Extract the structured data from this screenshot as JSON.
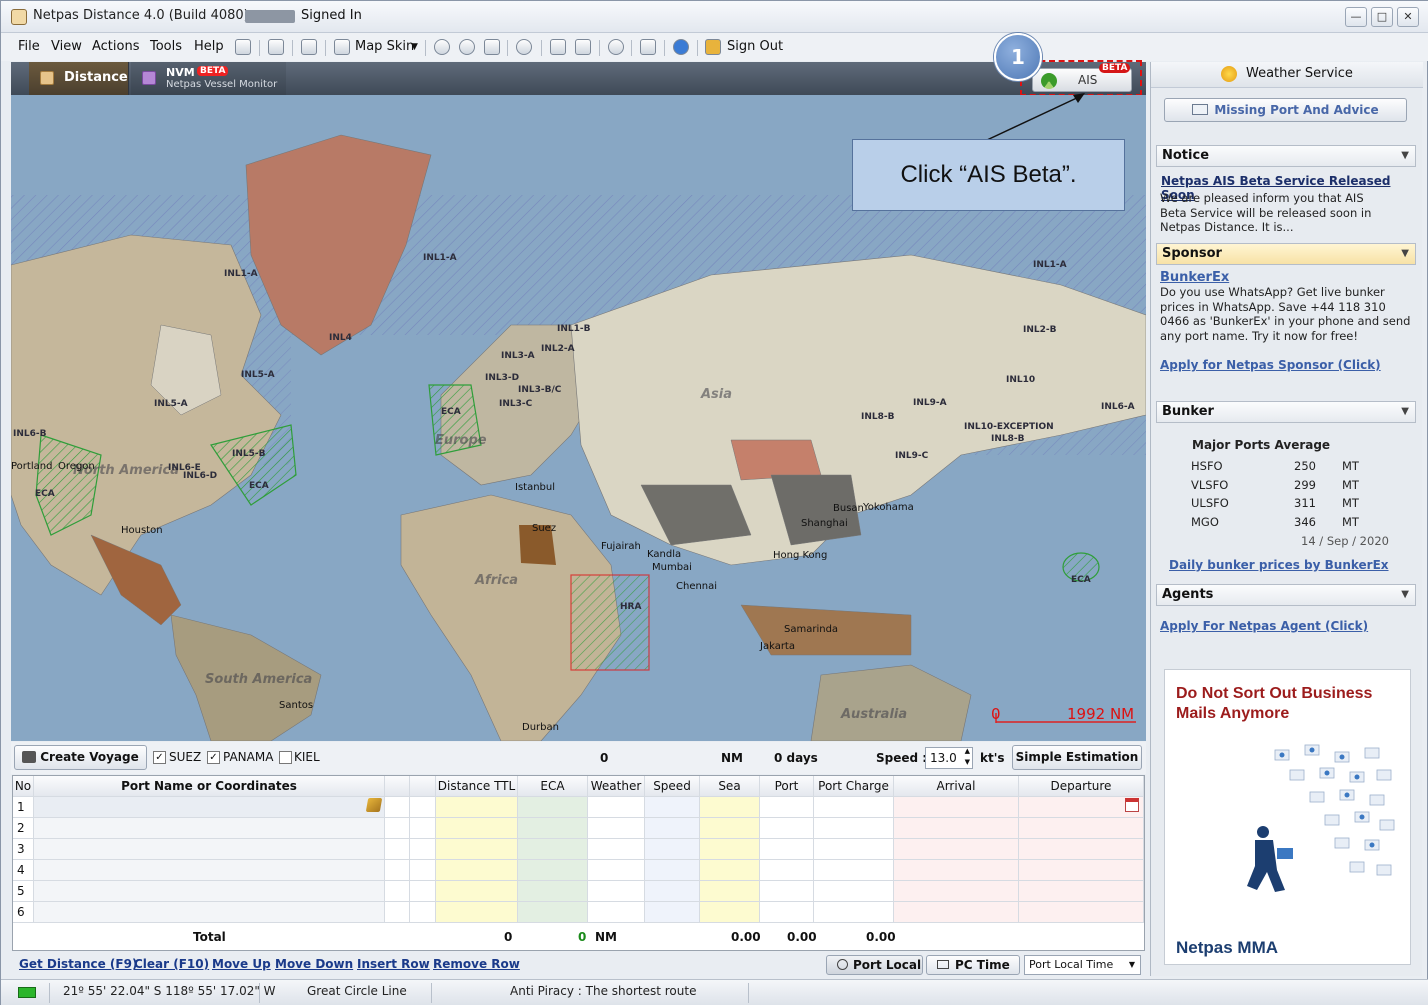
{
  "window": {
    "title": "Netpas Distance 4.0 (Build 4080)  -",
    "signed_in": "Signed In"
  },
  "menu": {
    "items": [
      "File",
      "View",
      "Actions",
      "Tools",
      "Help"
    ],
    "map_skin": "Map Skin",
    "sign_out": "Sign Out"
  },
  "tabs": {
    "distance": "Distance",
    "nvm_title": "NVM",
    "nvm_beta": "BETA",
    "nvm_sub": "Netpas Vessel Monitor",
    "ais": "AIS",
    "ais_beta": "BETA"
  },
  "callout": {
    "number": "1",
    "text": "Click “AIS Beta”."
  },
  "map": {
    "scale_zero": "0",
    "scale_value": "1992 NM",
    "regions": [
      "North America",
      "Europe",
      "Asia",
      "Africa",
      "South America",
      "Australia"
    ],
    "zones": [
      "INL1-A",
      "INL1-A",
      "INL1-A",
      "INL4",
      "INL5-A",
      "INL5-A",
      "INL5-B",
      "INL1-B",
      "INL2-A",
      "INL3-A",
      "INL3-D",
      "INL3-B/C",
      "INL3-C",
      "INL2-B",
      "INL10",
      "INL6-A",
      "INL9-A",
      "INL8-B",
      "INL10-EXCEPTION",
      "INL8-B",
      "INL9-C",
      "HRA",
      "ECA",
      "ECA",
      "ECA",
      "ECA",
      "INL6-B",
      "INL6-E",
      "INL6-D"
    ],
    "cities": [
      "Portland",
      "Oregon",
      "Houston",
      "Istanbul",
      "Suez",
      "Fujairah",
      "Kandla",
      "Mumbai",
      "Chennai",
      "Busan",
      "Yokohama",
      "Shanghai",
      "Hong Kong",
      "Samarinda",
      "Jakarta",
      "Santos",
      "Durban"
    ]
  },
  "voyage": {
    "create_voyage": "Create Voyage",
    "suez": "SUEZ",
    "panama": "PANAMA",
    "kiel": "KIEL",
    "suez_checked": true,
    "panama_checked": true,
    "kiel_checked": false,
    "distance_value": "0",
    "nm_label": "NM",
    "days": "0 days",
    "speed_label": "Speed :",
    "speed_value": "13.0",
    "kts": "kt's",
    "simple_estimation": "Simple Estimation"
  },
  "grid": {
    "columns": [
      "No",
      "Port Name or Coordinates",
      "",
      "",
      "Distance TTL",
      "ECA",
      "Weather",
      "Speed",
      "Sea",
      "Port",
      "Port Charge",
      "Arrival",
      "Departure"
    ],
    "rows": [
      "1",
      "2",
      "3",
      "4",
      "5",
      "6"
    ],
    "total_label": "Total",
    "total_distance": "0",
    "total_eca": "0",
    "total_nm": "NM",
    "total_sea": "0.00",
    "total_port": "0.00",
    "total_charge": "0.00"
  },
  "bottom": {
    "links": [
      "Get Distance (F9)",
      "Clear (F10)",
      "Move Up",
      "Move Down",
      "Insert Row",
      "Remove Row"
    ],
    "port_local": "Port Local",
    "pc_time": "PC Time",
    "time_select": "Port Local Time"
  },
  "status": {
    "coords": "21º 55' 22.04\" S 118º 55' 17.02\" W",
    "route_type": "Great Circle Line",
    "anti_piracy": "Anti Piracy : The shortest route"
  },
  "right_panel": {
    "weather_service": "Weather Service",
    "missing_port": "Missing Port And Advice",
    "notice_head": "Notice",
    "notice_title": "Netpas AIS Beta Service Released Soon",
    "notice_body": "We are pleased inform you that AIS Beta Service will be released soon in Netpas Distance. It is...",
    "sponsor_head": "Sponsor",
    "sponsor_title": "BunkerEx",
    "sponsor_body": "Do you use WhatsApp? Get live bunker prices in WhatsApp. Save +44 118 310 0466 as 'BunkerEx' in your phone and send any port name. Try it now for free!",
    "sponsor_apply": "Apply for Netpas Sponsor (Click)",
    "bunker_head": "Bunker",
    "bunker_sub": "Major Ports Average",
    "bunker_rows": [
      {
        "fuel": "HSFO",
        "price": "250",
        "unit": "MT"
      },
      {
        "fuel": "VLSFO",
        "price": "299",
        "unit": "MT"
      },
      {
        "fuel": "ULSFO",
        "price": "311",
        "unit": "MT"
      },
      {
        "fuel": "MGO",
        "price": "346",
        "unit": "MT"
      }
    ],
    "bunker_date": "14 / Sep / 2020",
    "bunker_link": "Daily bunker prices by BunkerEx",
    "agents_head": "Agents",
    "agents_link": "Apply For Netpas Agent (Click)",
    "ad_title": "Do Not Sort Out Business Mails Anymore",
    "ad_brand": "Netpas MMA"
  },
  "colors": {
    "ocean": "#88a7c4",
    "accent_link": "#3b5fa8",
    "highlight": "#dd1111",
    "callout_fill": "#b9cfe9"
  }
}
